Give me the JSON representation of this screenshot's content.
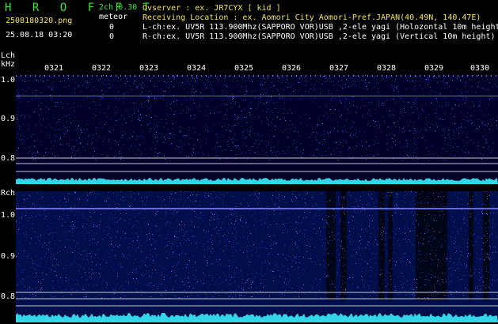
{
  "header": {
    "app_title": "H R O F F T",
    "filename": "2508180320.png",
    "datetime": "25.08.18 03:20",
    "channel_mode": "2ch 0.30",
    "meteor_label": "meteor",
    "meteor_count_l": "0",
    "meteor_count_r": "0"
  },
  "info": {
    "observer": "Ovserver              : ex. JR7CYX [ kid ]",
    "location": "Receiving Location : ex. Aomori City Aomori-Pref.JAPAN(40.49N, 140.47E)",
    "lch": "L-ch:ex. UV5R 113.900Mhz(SAPPORO VOR)USB ,2-ele yagi (Holozontal 10m height)",
    "rch": "R-ch:ex. UV5R 113.900Mhz(SAPPORO VOR)USB ,2-ele yagi (Vertical 10m height)"
  },
  "axes": {
    "lch_label": "Lch",
    "khz_label": "kHz",
    "rch_label": "Rch",
    "time_ticks": [
      "0321",
      "0322",
      "0323",
      "0324",
      "0325",
      "0326",
      "0327",
      "0328",
      "0329",
      "0330"
    ],
    "freq_ticks": [
      "1.0",
      "0.9",
      "0.8"
    ]
  },
  "colors": {
    "title": "#39e639",
    "info": "#f5e45a",
    "noise_trace": "#33d6e6",
    "carrier": "#6f7dff"
  }
}
